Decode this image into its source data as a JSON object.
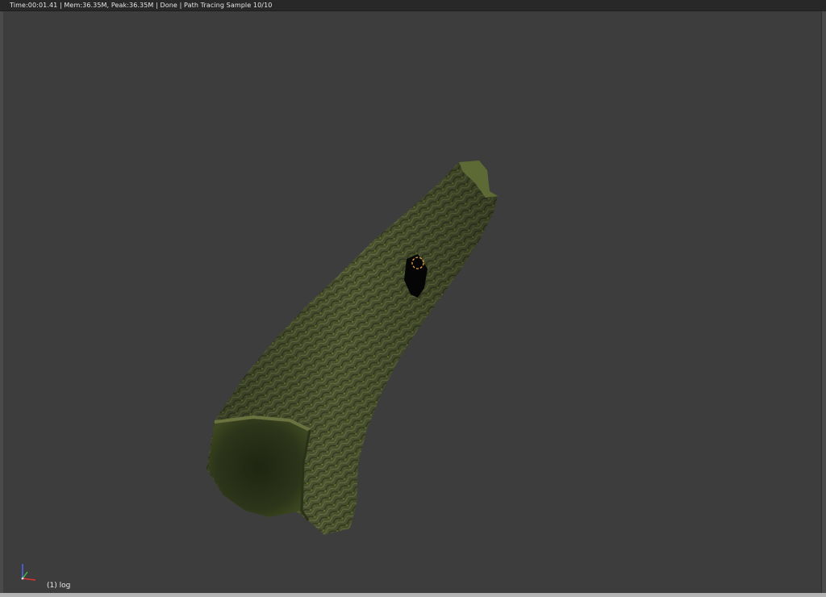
{
  "statusbar": {
    "text": "Time:00:01.41 | Mem:36.35M, Peak:36.35M | Done | Path Tracing Sample 10/10"
  },
  "viewport": {
    "object_label": "(1) log"
  },
  "icons": {
    "axis_gizmo": "axis-gizmo-icon",
    "origin_marker": "object-origin-icon"
  },
  "colors": {
    "background": "#3d3d3d",
    "statusbar": "#282828",
    "bark": "#4f5630",
    "moss": "#5f6b2c",
    "origin_marker": "#e8a34a"
  }
}
